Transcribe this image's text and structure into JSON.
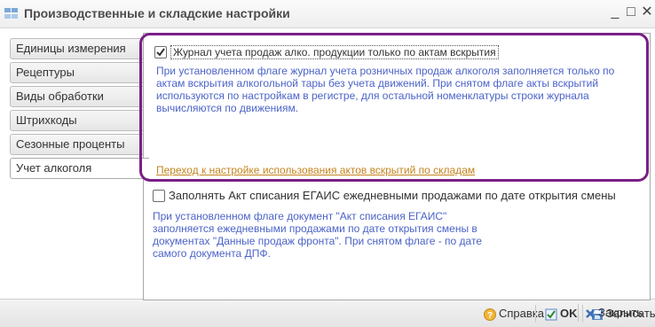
{
  "window": {
    "title": "Производственные и складские настройки",
    "controls": {
      "minimize": "_",
      "maximize": "□",
      "close": "✕"
    }
  },
  "tabs": [
    {
      "label": "Единицы измерения",
      "active": false
    },
    {
      "label": "Рецептуры",
      "active": false
    },
    {
      "label": "Виды обработки",
      "active": false
    },
    {
      "label": "Штрихкоды",
      "active": false
    },
    {
      "label": "Сезонные проценты",
      "active": false
    },
    {
      "label": "Учет алкоголя",
      "active": true
    }
  ],
  "options": [
    {
      "checked": true,
      "label": "Журнал учета продаж алко. продукции только по актам вскрытия",
      "description": "При установленном флаге журнал учета розничных продаж алкоголя заполняется только по актам вскрытия алкогольной тары без учета движений. При снятом флаге акты вскрытий используются по настройкам в регистре, для остальной номенклатуры строки журнала вычисляются по движениям.",
      "link": "Переход к настройке использования актов вскрытий по складам"
    },
    {
      "checked": false,
      "label": "Заполнять Акт списания ЕГАИС ежедневными продажами  по дате открытия смены",
      "description": "При установленном флаге документ \"Акт списания ЕГАИС\" заполняется ежедневными продажами по дате открытия смены в документах \"Данные продаж фронта\". При снятом флаге - по дате самого документа ДПФ."
    }
  ],
  "footer": {
    "help": "Справка",
    "ok": "OK",
    "save": "Записать",
    "close": "Закрыть"
  },
  "colors": {
    "highlight": "#7a1f86",
    "description_text": "#4b63c8",
    "link_text": "#c4841e"
  }
}
